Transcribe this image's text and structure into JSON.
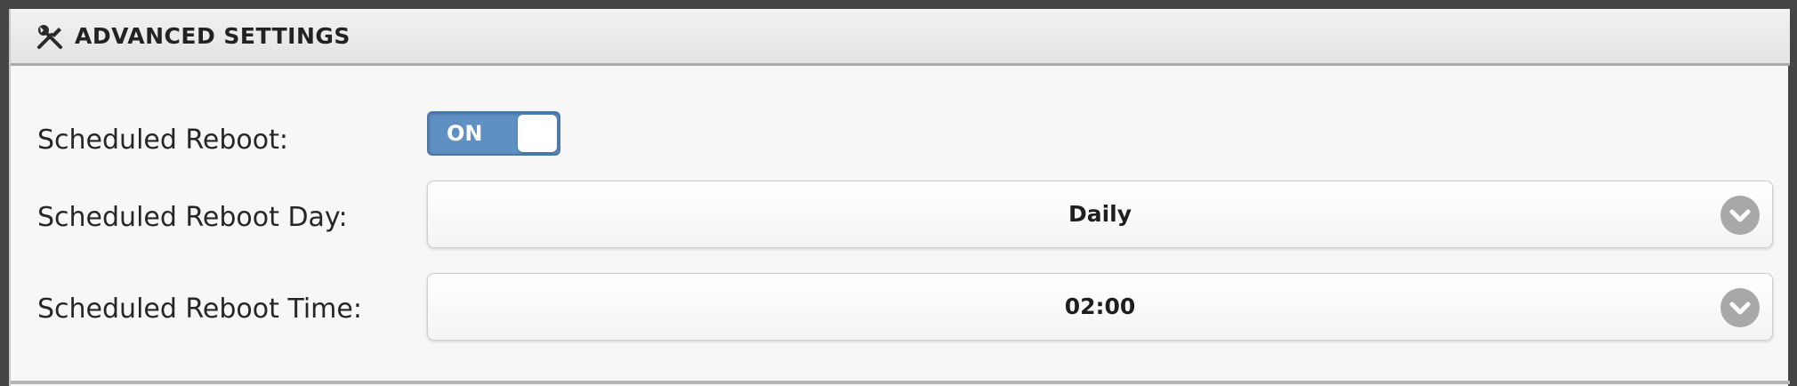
{
  "panel": {
    "title": "ADVANCED SETTINGS",
    "title_icon": "tools-icon"
  },
  "rows": {
    "reboot": {
      "label": "Scheduled Reboot:",
      "toggle_text": "ON",
      "toggle_state": "on"
    },
    "reboot_day": {
      "label": "Scheduled Reboot Day:",
      "value": "Daily"
    },
    "reboot_time": {
      "label": "Scheduled Reboot Time:",
      "value": "02:00"
    }
  },
  "colors": {
    "toggle_on": "#5f90c4",
    "dropdown_arrow": "#a8a8a8",
    "header_border": "#a9a9a9"
  }
}
